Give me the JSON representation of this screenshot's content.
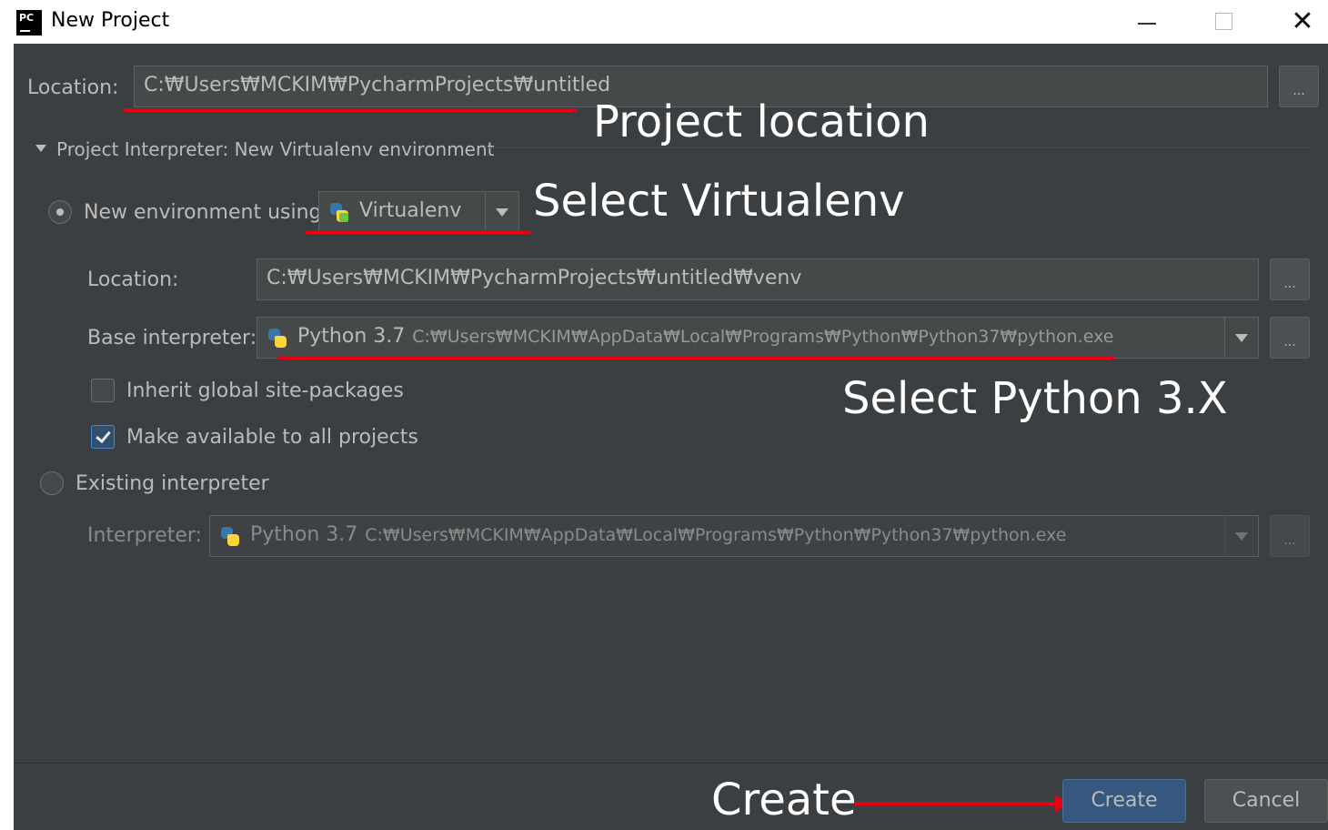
{
  "window": {
    "title": "New Project",
    "app_icon_text": "PC",
    "controls": {
      "close": "✕"
    }
  },
  "form": {
    "location_label": "Location:",
    "location_value": "C:₩Users₩MCKIM₩PycharmProjects₩untitled",
    "browse_label": "...",
    "section_title": "Project Interpreter: New Virtualenv environment",
    "new_env_label": "New environment using",
    "env_tool": "Virtualenv",
    "venv_location_label": "Location:",
    "venv_location_value": "C:₩Users₩MCKIM₩PycharmProjects₩untitled₩venv",
    "base_interpreter_label": "Base interpreter:",
    "base_interpreter_name": "Python 3.7",
    "base_interpreter_path": "C:₩Users₩MCKIM₩AppData₩Local₩Programs₩Python₩Python37₩python.exe",
    "inherit_label": "Inherit global site-packages",
    "inherit_checked": false,
    "make_available_label": "Make available to all projects",
    "make_available_checked": true,
    "existing_label": "Existing interpreter",
    "interpreter_label": "Interpreter:",
    "interpreter_name": "Python 3.7",
    "interpreter_path": "C:₩Users₩MCKIM₩AppData₩Local₩Programs₩Python₩Python37₩python.exe"
  },
  "buttons": {
    "create": "Create",
    "cancel": "Cancel"
  },
  "annotations": {
    "project_location": "Project location",
    "select_virtualenv": "Select Virtualenv",
    "select_python": "Select Python 3.X",
    "create": "Create",
    "color": "#e60012"
  }
}
